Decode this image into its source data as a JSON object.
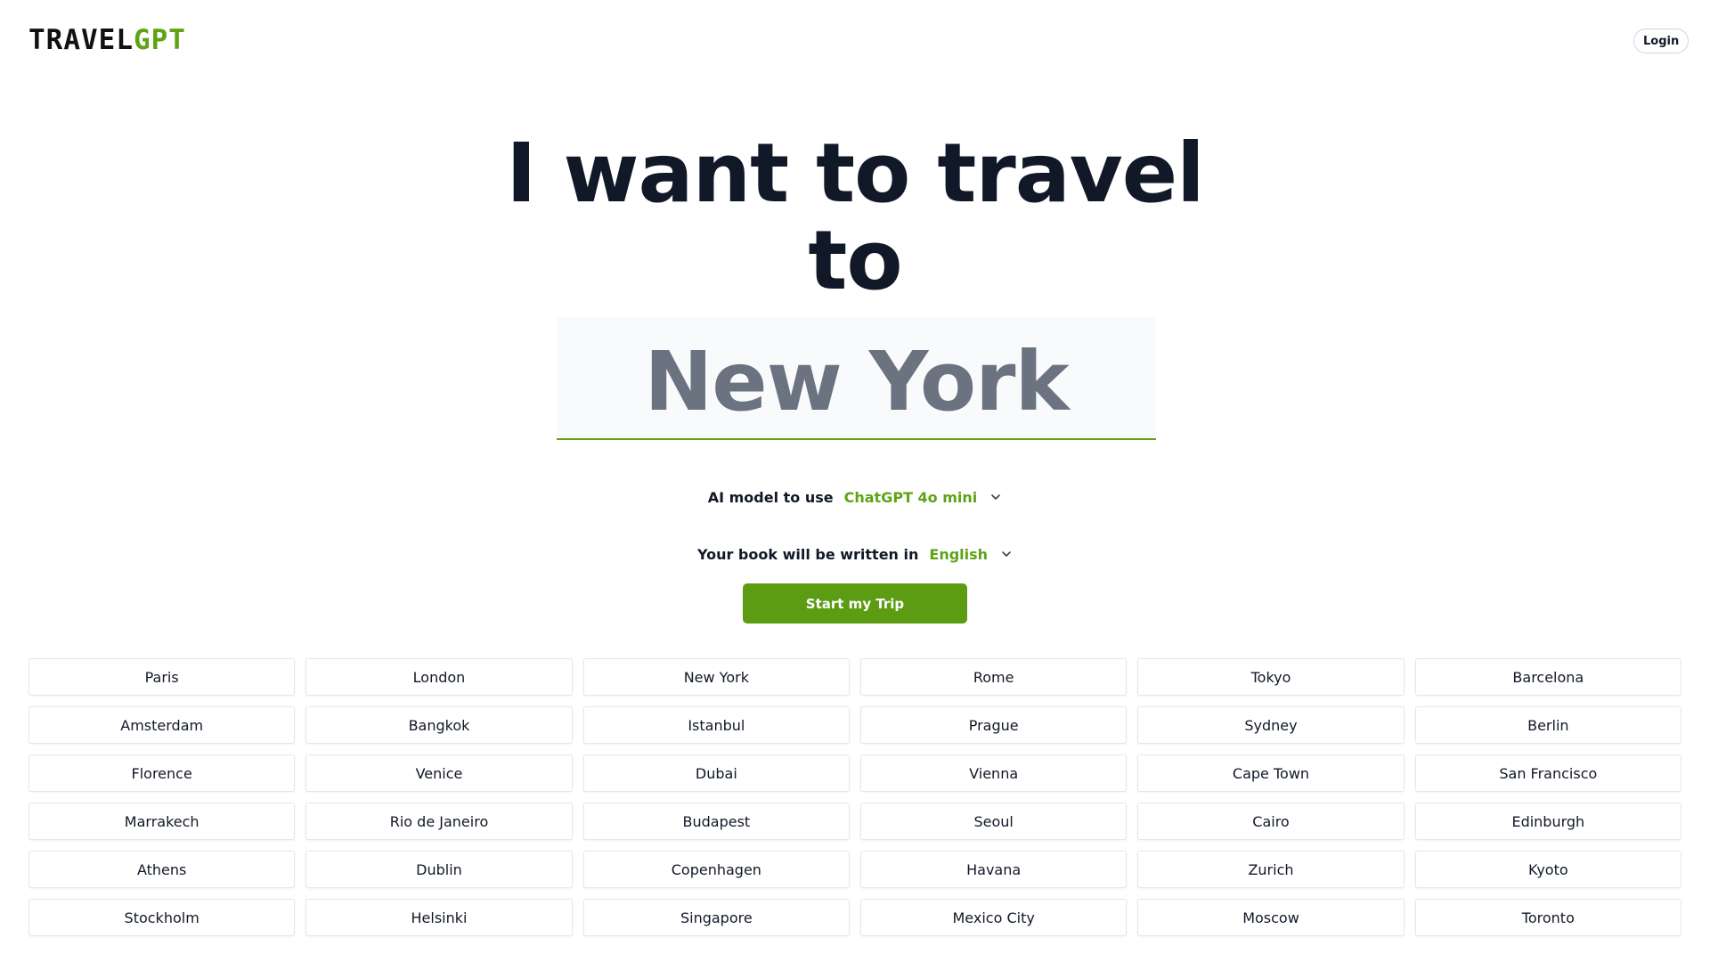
{
  "header": {
    "logo_part1": "TRAVEL",
    "logo_part2": "GPT",
    "login_label": "Login"
  },
  "hero": {
    "line1": "I want to travel",
    "line2": "to",
    "destination_value": "New York"
  },
  "model_selector": {
    "label": "AI model to use",
    "value": "ChatGPT 4o mini",
    "icon": "chevron-down-icon"
  },
  "language_selector": {
    "label": "Your book will be written in",
    "value": "English",
    "icon": "chevron-down-icon"
  },
  "start_button": {
    "label": "Start my Trip"
  },
  "cities": [
    "Paris",
    "London",
    "New York",
    "Rome",
    "Tokyo",
    "Barcelona",
    "Amsterdam",
    "Bangkok",
    "Istanbul",
    "Prague",
    "Sydney",
    "Berlin",
    "Florence",
    "Venice",
    "Dubai",
    "Vienna",
    "Cape Town",
    "San Francisco",
    "Marrakech",
    "Rio de Janeiro",
    "Budapest",
    "Seoul",
    "Cairo",
    "Edinburgh",
    "Athens",
    "Dublin",
    "Copenhagen",
    "Havana",
    "Zurich",
    "Kyoto",
    "Stockholm",
    "Helsinki",
    "Singapore",
    "Mexico City",
    "Moscow",
    "Toronto"
  ],
  "colors": {
    "accent": "#5fa314",
    "button": "#5c9c13",
    "title": "#111827",
    "destination_text": "#6b7280",
    "destination_bg": "#f8fafc"
  }
}
